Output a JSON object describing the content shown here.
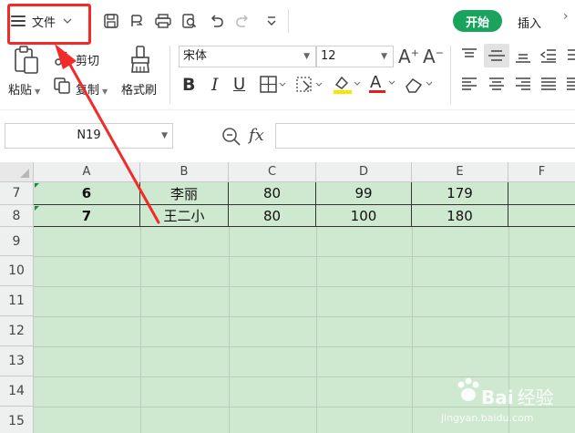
{
  "menubar": {
    "file_label": "文件",
    "tabs": [
      {
        "label": "开始",
        "active": true
      },
      {
        "label": "插入",
        "active": false
      }
    ]
  },
  "ribbon": {
    "paste_label": "粘贴",
    "cut_label": "剪切",
    "copy_label": "复制",
    "format_painter_label": "格式刷",
    "font_name": "宋体",
    "font_size": "12",
    "font_color": "#e02020",
    "highlight_color": "#f5e600"
  },
  "formula_bar": {
    "cell_reference": "N19",
    "fx_label": "fx",
    "formula_value": ""
  },
  "sheet": {
    "columns": [
      "A",
      "B",
      "C",
      "D",
      "E",
      "F"
    ],
    "row_numbers": [
      "7",
      "8",
      "9",
      "10",
      "11",
      "12",
      "13",
      "14",
      "15"
    ],
    "rows": [
      {
        "row": "7",
        "cells": [
          "6",
          "李丽",
          "80",
          "99",
          "179",
          ""
        ]
      },
      {
        "row": "8",
        "cells": [
          "7",
          "王二小",
          "80",
          "100",
          "180",
          ""
        ]
      }
    ],
    "fill_color": "#cfe8d0"
  },
  "annotation": {
    "box_color": "#f22a2a",
    "arrow_color": "#f22a2a"
  },
  "watermark": {
    "brand": "Bai",
    "brand_suffix": "经验",
    "url": "jingyan.baidu.com"
  }
}
